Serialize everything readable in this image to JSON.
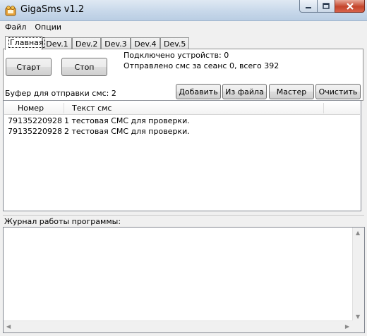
{
  "window": {
    "title": "GigaSms v1.2"
  },
  "menu": [
    {
      "label": "Файл"
    },
    {
      "label": "Опции"
    }
  ],
  "tabs": [
    {
      "label": "Главная",
      "active": true
    },
    {
      "label": "Dev.1"
    },
    {
      "label": "Dev.2"
    },
    {
      "label": "Dev.3"
    },
    {
      "label": "Dev.4"
    },
    {
      "label": "Dev.5"
    }
  ],
  "main": {
    "start_label": "Старт",
    "stop_label": "Стоп",
    "connected_devices": "Подключено устройств: 0",
    "sent_stats": "Отправлено смс за сеанс 0, всего 392"
  },
  "buffer": {
    "label": "Буфер для отправки смс: 2",
    "add_label": "Добавить",
    "from_file_label": "Из файла",
    "wizard_label": "Мастер",
    "clear_label": "Очистить",
    "columns": [
      "Номер",
      "Текст смс"
    ],
    "rows": [
      {
        "number": "79135220928",
        "text": "1 тестовая СМС для проверки."
      },
      {
        "number": "79135220928",
        "text": "2 тестовая СМС для проверки."
      }
    ]
  },
  "log": {
    "label": "Журнал работы программы:",
    "text": ""
  },
  "colors": {
    "titlebar": "#c8d8ea",
    "close_button": "#c4452c",
    "window_bg": "#f0f0f0"
  },
  "icons": [
    "app-icon",
    "minimize-icon",
    "maximize-icon",
    "close-icon"
  ]
}
